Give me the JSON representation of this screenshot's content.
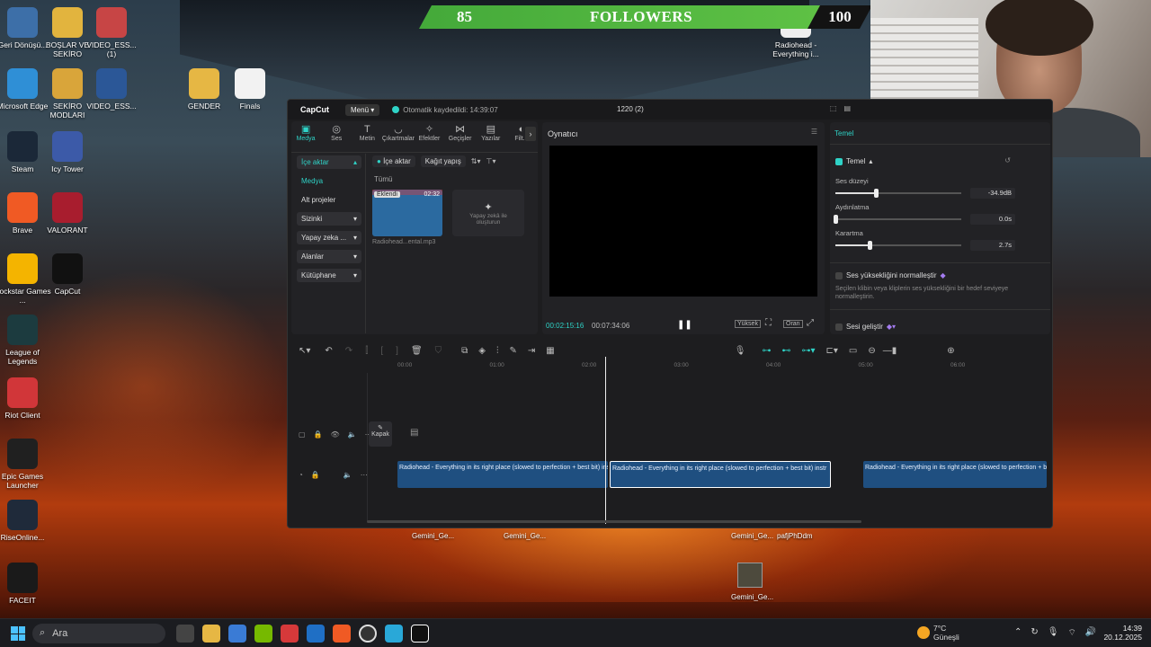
{
  "stream": {
    "followers_current": "85",
    "followers_label": "FOLLOWERS",
    "followers_goal": "100"
  },
  "desktop": {
    "icons": [
      {
        "label": "Geri Dönüşü...",
        "icon": "recycle-bin-icon",
        "color": "#3d6fa8"
      },
      {
        "label": "BOŞLAR VE SEKİRO",
        "icon": "folder-icon",
        "color": "#e2b43e"
      },
      {
        "label": "VIDEO_ESS... (1)",
        "icon": "ppt-file-icon",
        "color": "#c74545"
      },
      {
        "label": "Microsoft Edge",
        "icon": "edge-icon",
        "color": "#2f8fd6"
      },
      {
        "label": "SEKİRO MODLARI",
        "icon": "folder-icon",
        "color": "#d9a53a"
      },
      {
        "label": "VIDEO_ESS...",
        "icon": "word-file-icon",
        "color": "#2b5797"
      },
      {
        "label": "GENDER",
        "icon": "folder-icon",
        "color": "#e6b744"
      },
      {
        "label": "Finals",
        "icon": "file-icon",
        "color": "#f2f2f2"
      },
      {
        "label": "Steam",
        "icon": "steam-icon",
        "color": "#1b2838"
      },
      {
        "label": "Icy Tower",
        "icon": "icy-tower-icon",
        "color": "#3c5aa8"
      },
      {
        "label": "Brave",
        "icon": "brave-icon",
        "color": "#f05a24"
      },
      {
        "label": "VALORANT",
        "icon": "valorant-icon",
        "color": "#a81d2e"
      },
      {
        "label": "Rockstar Games ...",
        "icon": "rockstar-icon",
        "color": "#f4b400"
      },
      {
        "label": "CapCut",
        "icon": "capcut-icon",
        "color": "#111111"
      },
      {
        "label": "League of Legends",
        "icon": "league-icon",
        "color": "#1c3b3f"
      },
      {
        "label": "Riot Client",
        "icon": "riot-icon",
        "color": "#d13639"
      },
      {
        "label": "Epic Games Launcher",
        "icon": "epic-icon",
        "color": "#202020"
      },
      {
        "label": "RiseOnline...",
        "icon": "riseonline-icon",
        "color": "#1f2a3a"
      },
      {
        "label": "FACEIT",
        "icon": "faceit-icon",
        "color": "#1a1a1a"
      },
      {
        "label": "Radiohead - Everything i...",
        "icon": "media-file-icon",
        "color": "#eeeeee"
      }
    ],
    "bottom_labels": [
      "Gemini_Ge...",
      "Gemini_Ge...",
      "Gemini_Ge...",
      "pafjPhDdm",
      "Gemini_Ge..."
    ]
  },
  "capcut": {
    "app_name": "CapCut",
    "menu_label": "Menü",
    "autosave": "Otomatik kaydedildi: 14:39:07",
    "project_title": "1220 (2)",
    "tools": [
      "Medya",
      "Ses",
      "Metin",
      "Çıkartmalar",
      "Efektler",
      "Geçişler",
      "Yazılar",
      "Filt..."
    ],
    "sidebar": [
      "İçe aktar",
      "Medya",
      "Alt projeler",
      "Sizinki",
      "Yapay zeka ...",
      "Alanlar",
      "Kütüphane"
    ],
    "media_toolbar": {
      "import": "İçe aktar",
      "draft": "Kağıt yapış"
    },
    "media_section": "Tümü",
    "clip": {
      "tag": "Eklendi",
      "duration": "02:32",
      "name": "Radiohead...ental.mp3"
    },
    "ai_card": "Yapay zekâ ile oluşturun",
    "player": {
      "title": "Oynatıcı",
      "current": "00:02:15:16",
      "total": "00:07:34:06",
      "quality": "Yüksek",
      "ratio": "Oran"
    },
    "inspector": {
      "tab": "Temel",
      "section": "Temel",
      "volume_label": "Ses düzeyi",
      "volume_value": "-34.9dB",
      "volume_level": 0.32,
      "fadein_label": "Aydınlatma",
      "fadein_value": "0.0s",
      "fadein_level": 0.0,
      "fadeout_label": "Karartma",
      "fadeout_value": "2.7s",
      "fadeout_level": 0.27,
      "normalize_label": "Ses yüksekliğini normalleştir",
      "normalize_desc": "Seçilen klibin veya kliplerin ses yüksekliğini bir hedef seviyeye normalleştirin.",
      "enhance_label": "Sesi geliştir"
    },
    "timeline": {
      "ruler": [
        "00:00",
        "01:00",
        "02:00",
        "03:00",
        "04:00",
        "05:00",
        "06:00"
      ],
      "cover_label": "Kapak",
      "clip_text": "Radiohead - Everything in its right place (slowed to perfection + best bit) instr"
    }
  },
  "taskbar": {
    "search_placeholder": "Ara",
    "weather_temp": "7°C",
    "weather_desc": "Güneşli",
    "time": "14:39",
    "date": "20.12.2025"
  }
}
